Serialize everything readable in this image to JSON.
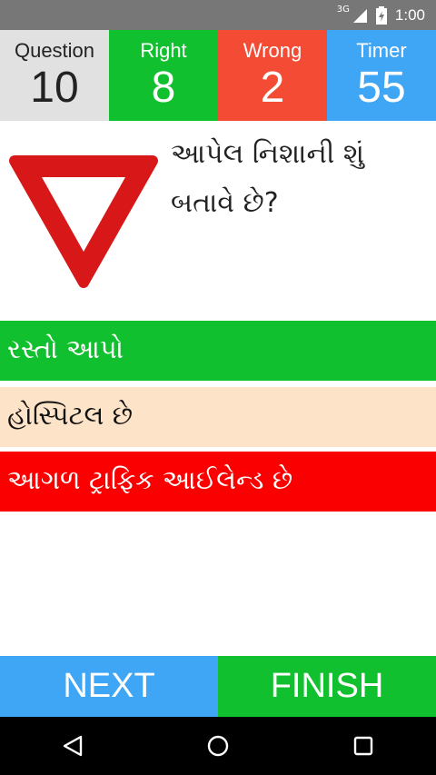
{
  "status_bar": {
    "network": "3G",
    "time": "1:00"
  },
  "stats": [
    {
      "label": "Question",
      "value": "10",
      "bg": "#e1e1e1",
      "color": "#222222"
    },
    {
      "label": "Right",
      "value": "8",
      "bg": "#11c02e",
      "color": "#ffffff"
    },
    {
      "label": "Wrong",
      "value": "2",
      "bg": "#f44b35",
      "color": "#ffffff"
    },
    {
      "label": "Timer",
      "value": "55",
      "bg": "#3fa5f5",
      "color": "#ffffff"
    }
  ],
  "question": {
    "text": "આપેલ નિશાની શું બતાવે છે?",
    "sign_icon": "yield-sign-icon"
  },
  "answers": [
    {
      "text": "રસ્તો આપો"
    },
    {
      "text": "હોસ્પિટલ છે"
    },
    {
      "text": "આગળ ટ્રાફિક આઈલેન્ડ છે"
    }
  ],
  "buttons": {
    "next": {
      "label": "NEXT",
      "bg": "#3fa5f5"
    },
    "finish": {
      "label": "FINISH",
      "bg": "#11c02e"
    }
  },
  "nav_icons": [
    "back-icon",
    "home-icon",
    "recents-icon"
  ]
}
